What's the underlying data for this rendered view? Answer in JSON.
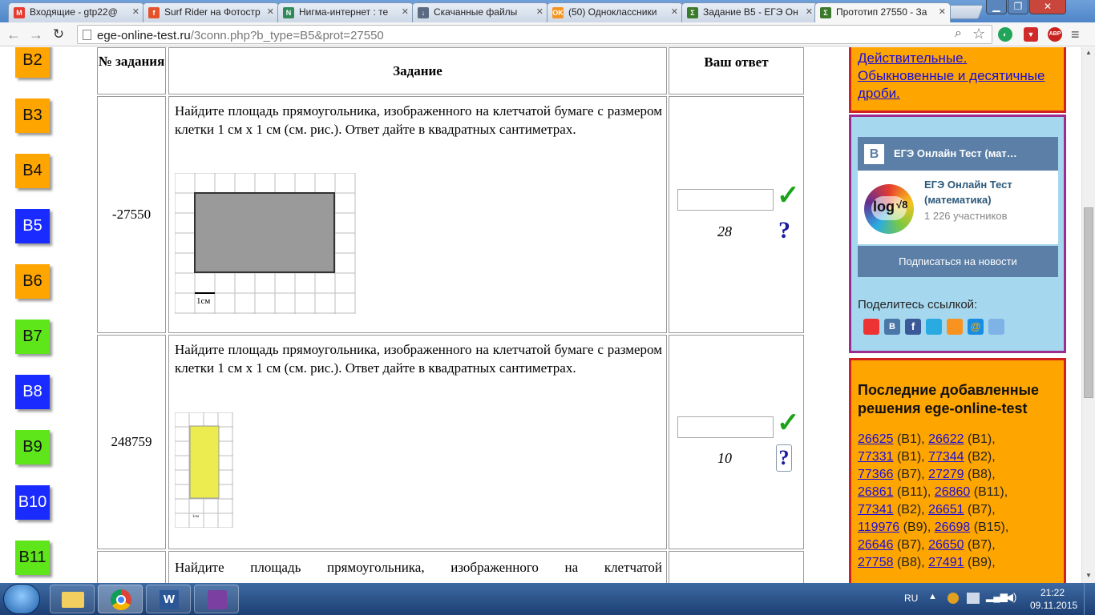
{
  "browser": {
    "tabs": [
      {
        "title": "Входящие - gtp22@",
        "color": "#e63b2e",
        "fav": "M"
      },
      {
        "title": "Surf Rider на Фотостр",
        "color": "#e5522a",
        "fav": "f"
      },
      {
        "title": "Нигма-интернет : те",
        "color": "#2e8b57",
        "fav": "N"
      },
      {
        "title": "Скачанные файлы",
        "color": "#5a6a80",
        "fav": "↓"
      },
      {
        "title": "(50) Одноклассники",
        "color": "#f7931e",
        "fav": "OK"
      },
      {
        "title": "Задание B5 - ЕГЭ Он",
        "color": "#3a7a2a",
        "fav": "Σ"
      },
      {
        "title": "Прототип 27550 - За",
        "color": "#3a7a2a",
        "fav": "Σ"
      }
    ],
    "url_host": "ege-online-test.ru",
    "url_path": "/3conn.php?b_type=B5&prot=27550",
    "ext_abp": "ABP"
  },
  "sidebar": {
    "buttons": [
      "B2",
      "B3",
      "B4",
      "B5",
      "B6",
      "B7",
      "B8",
      "B9",
      "B10",
      "B11"
    ],
    "colors": [
      "or",
      "or",
      "or",
      "bl",
      "or",
      "gr",
      "bl",
      "gr",
      "bl",
      "gr"
    ]
  },
  "table": {
    "headers": {
      "number": "№ задания",
      "task": "Задание",
      "answer": "Ваш ответ"
    },
    "rows": [
      {
        "id": "-27550",
        "text": "Найдите площадь прямоугольника, изображенного на клетчатой бумаге с размером клетки 1 см х 1 см (см. рис.). Ответ дайте в квадратных сантиметрах.",
        "answer": "28",
        "figure_label": "1см"
      },
      {
        "id": "248759",
        "text": "Найдите площадь прямоугольника, изображенного на клетчатой бумаге с размером клетки 1 см х 1 см (см. рис.). Ответ дайте в квадратных сантиметрах.",
        "answer": "10",
        "figure_label": "1см"
      },
      {
        "id": "",
        "text": "Найдите площадь прямоугольника, изображенного на клетчатой",
        "answer": ""
      }
    ]
  },
  "right": {
    "top_box_text": "Действительные. Обыкновенные и десятичные дроби.",
    "vk": {
      "header": "ЕГЭ Онлайн Тест (мат…",
      "group_name": "ЕГЭ Онлайн Тест (математика)",
      "members": "1 226 участников",
      "logo_text": "log",
      "logo_sub": "√8",
      "subscribe": "Подписаться на новости",
      "share_label": "Поделитесь ссылкой:"
    },
    "latest": {
      "title": "Последние добавленные решения ege-online-test",
      "items": [
        {
          "id": "26625",
          "type": "(B1),"
        },
        {
          "id": "26622",
          "type": "(B1),"
        },
        {
          "id": "77331",
          "type": "(B1),"
        },
        {
          "id": "77344",
          "type": "(B2),"
        },
        {
          "id": "77366",
          "type": "(B7),"
        },
        {
          "id": "27279",
          "type": "(B8),"
        },
        {
          "id": "26861",
          "type": "(B11),"
        },
        {
          "id": "26860",
          "type": "(B11),"
        },
        {
          "id": "77341",
          "type": "(B2),"
        },
        {
          "id": "26651",
          "type": "(B7),"
        },
        {
          "id": "119976",
          "type": "(B9),"
        },
        {
          "id": "26698",
          "type": "(B15),"
        },
        {
          "id": "26646",
          "type": "(B7),"
        },
        {
          "id": "26650",
          "type": "(B7),"
        },
        {
          "id": "27758",
          "type": "(B8),"
        },
        {
          "id": "27491",
          "type": "(B9),"
        }
      ]
    }
  },
  "taskbar": {
    "lang": "RU",
    "time": "21:22",
    "date": "09.11.2015"
  }
}
